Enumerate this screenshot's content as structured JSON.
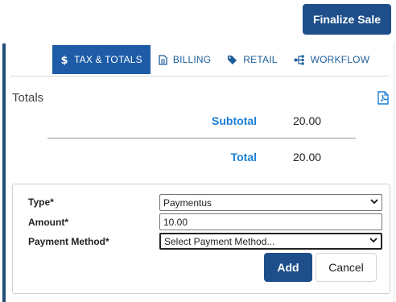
{
  "header": {
    "finalize_label": "Finalize Sale"
  },
  "tabs": [
    {
      "label": "TAX & TOTALS",
      "icon": "dollar-icon",
      "active": true
    },
    {
      "label": "BILLING",
      "icon": "document-icon",
      "active": false
    },
    {
      "label": "RETAIL",
      "icon": "tag-icon",
      "active": false
    },
    {
      "label": "WORKFLOW",
      "icon": "workflow-icon",
      "active": false
    }
  ],
  "totals": {
    "title": "Totals",
    "pdf_icon": "pdf-icon",
    "subtotal_label": "Subtotal",
    "subtotal_value": "20.00",
    "total_label": "Total",
    "total_value": "20.00"
  },
  "payment": {
    "type_label": "Type*",
    "type_value": "Paymentus",
    "amount_label": "Amount*",
    "amount_value": "10.00",
    "method_label": "Payment Method*",
    "method_value": "Select Payment Method...",
    "add_label": "Add",
    "cancel_label": "Cancel"
  },
  "colors": {
    "primary": "#1e4f8a",
    "active_tab": "#1e5ca8",
    "link": "#1a7fd6"
  }
}
